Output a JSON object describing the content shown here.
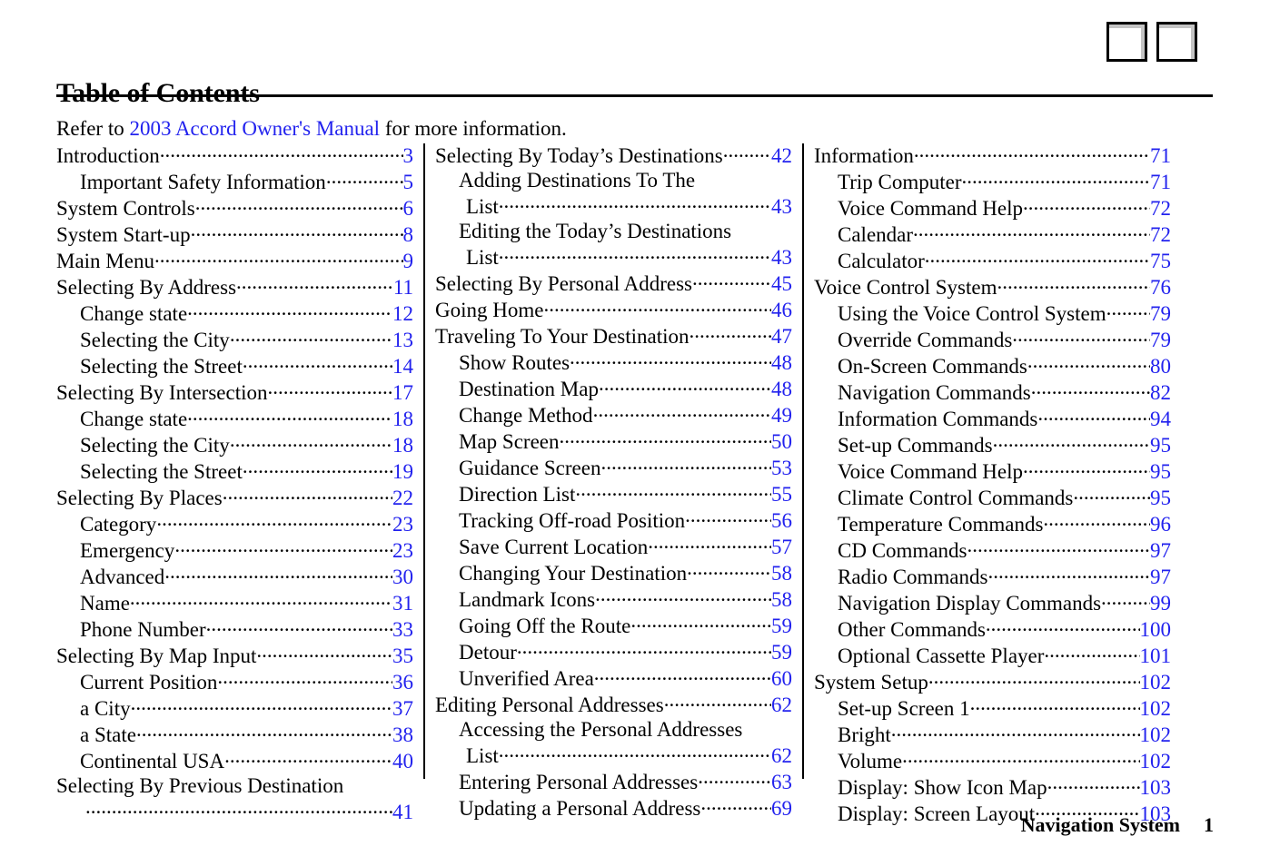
{
  "header": {
    "placeholder_boxes": [
      "image-placeholder-1",
      "image-placeholder-2"
    ]
  },
  "title": "Table of Contents",
  "intro": {
    "before": "Refer to ",
    "link": "2003 Accord Owner's Manual",
    "after": " for more information."
  },
  "columns": [
    {
      "id": "column-1",
      "entries": [
        {
          "label": "Introduction",
          "page": "3",
          "level": 1,
          "dots": true
        },
        {
          "label": "Important Safety Information",
          "page": "5",
          "level": 2,
          "dots": true
        },
        {
          "label": "System Controls",
          "page": "6",
          "level": 1,
          "dots": true
        },
        {
          "label": "System Start-up",
          "page": "8",
          "level": 1,
          "dots": true
        },
        {
          "label": "Main Menu",
          "page": "9",
          "level": 1,
          "dots": true
        },
        {
          "label": "Selecting By Address",
          "page": "11",
          "level": 1,
          "dots": true
        },
        {
          "label": "Change state",
          "page": "12",
          "level": 2,
          "dots": true
        },
        {
          "label": "Selecting the City",
          "page": "13",
          "level": 2,
          "dots": true
        },
        {
          "label": "Selecting the Street",
          "page": "14",
          "level": 2,
          "dots": true
        },
        {
          "label": "Selecting By Intersection",
          "page": "17",
          "level": 1,
          "dots": true
        },
        {
          "label": "Change state",
          "page": "18",
          "level": 2,
          "dots": true
        },
        {
          "label": "Selecting the City",
          "page": "18",
          "level": 2,
          "dots": true
        },
        {
          "label": "Selecting the Street",
          "page": "19",
          "level": 2,
          "dots": true
        },
        {
          "label": "Selecting By Places",
          "page": "22",
          "level": 1,
          "dots": true
        },
        {
          "label": "Category",
          "page": "23",
          "level": 2,
          "dots": true
        },
        {
          "label": "Emergency",
          "page": "23",
          "level": 2,
          "dots": true
        },
        {
          "label": "Advanced",
          "page": "30",
          "level": 2,
          "dots": true
        },
        {
          "label": "Name",
          "page": "31",
          "level": 2,
          "dots": true
        },
        {
          "label": "Phone Number",
          "page": "33",
          "level": 2,
          "dots": true
        },
        {
          "label": "Selecting By Map Input",
          "page": "35",
          "level": 1,
          "dots": true
        },
        {
          "label": "Current Position",
          "page": "36",
          "level": 2,
          "dots": true
        },
        {
          "label": "a City",
          "page": "37",
          "level": 2,
          "dots": true
        },
        {
          "label": "a State",
          "page": "38",
          "level": 2,
          "dots": true
        },
        {
          "label": "Continental USA",
          "page": "40",
          "level": 2,
          "dots": true
        },
        {
          "wrap_first": "Selecting By Previous Destination",
          "label": "",
          "page": "41",
          "level": 1,
          "dots": true,
          "continuation": true
        }
      ]
    },
    {
      "id": "column-2",
      "entries": [
        {
          "label": "Selecting By Today’s Destinations",
          "page": "42",
          "level": 1,
          "dots": true
        },
        {
          "wrap_first": "Adding Destinations To The",
          "label": "List",
          "page": "43",
          "level": 2,
          "dots": true,
          "continuation": true
        },
        {
          "wrap_first": "Editing the Today’s Destinations",
          "label": "List",
          "page": "43",
          "level": 2,
          "dots": true,
          "continuation": true
        },
        {
          "label": "Selecting By Personal Address",
          "page": "45",
          "level": 1,
          "dots": true
        },
        {
          "label": "Going Home",
          "page": "46",
          "level": 1,
          "dots": true
        },
        {
          "label": "Traveling To Your Destination",
          "page": "47",
          "level": 1,
          "dots": true
        },
        {
          "label": "Show Routes",
          "page": "48",
          "level": 2,
          "dots": true
        },
        {
          "label": "Destination Map",
          "page": "48",
          "level": 2,
          "dots": true
        },
        {
          "label": "Change Method",
          "page": "49",
          "level": 2,
          "dots": true
        },
        {
          "label": "Map Screen",
          "page": "50",
          "level": 2,
          "dots": true
        },
        {
          "label": "Guidance Screen",
          "page": "53",
          "level": 2,
          "dots": true
        },
        {
          "label": "Direction List",
          "page": "55",
          "level": 2,
          "dots": true
        },
        {
          "label": "Tracking Off-road Position",
          "page": "56",
          "level": 2,
          "dots": true
        },
        {
          "label": "Save Current Location",
          "page": "57",
          "level": 2,
          "dots": true
        },
        {
          "label": "Changing Your Destination",
          "page": "58",
          "level": 2,
          "dots": true
        },
        {
          "label": "Landmark Icons",
          "page": "58",
          "level": 2,
          "dots": true
        },
        {
          "label": "Going Off the Route",
          "page": "59",
          "level": 2,
          "dots": true
        },
        {
          "label": "Detour",
          "page": "59",
          "level": 2,
          "dots": true
        },
        {
          "label": "Unverified Area",
          "page": "60",
          "level": 2,
          "dots": true
        },
        {
          "label": "Editing Personal Addresses",
          "page": "62",
          "level": 1,
          "dots": true
        },
        {
          "wrap_first": "Accessing the Personal Addresses",
          "label": "List",
          "page": "62",
          "level": 2,
          "dots": true,
          "continuation": true
        },
        {
          "label": "Entering Personal Addresses",
          "page": "63",
          "level": 2,
          "dots": true
        },
        {
          "label": "Updating a Personal Address",
          "page": "69",
          "level": 2,
          "dots": true
        }
      ]
    },
    {
      "id": "column-3",
      "entries": [
        {
          "label": "Information",
          "page": "71",
          "level": 1,
          "dots": true
        },
        {
          "label": "Trip Computer",
          "page": "71",
          "level": 2,
          "dots": true
        },
        {
          "label": "Voice Command Help",
          "page": "72",
          "level": 2,
          "dots": true
        },
        {
          "label": "Calendar",
          "page": "72",
          "level": 2,
          "dots": true
        },
        {
          "label": "Calculator",
          "page": "75",
          "level": 2,
          "dots": true
        },
        {
          "label": "Voice Control System",
          "page": "76",
          "level": 1,
          "dots": true
        },
        {
          "label": "Using the Voice Control System",
          "page": "79",
          "level": 2,
          "dots": true
        },
        {
          "label": "Override Commands",
          "page": "79",
          "level": 2,
          "dots": true
        },
        {
          "label": "On-Screen Commands",
          "page": "80",
          "level": 2,
          "dots": true
        },
        {
          "label": "Navigation Commands",
          "page": "82",
          "level": 2,
          "dots": true
        },
        {
          "label": "Information Commands",
          "page": "94",
          "level": 2,
          "dots": true
        },
        {
          "label": "Set-up Commands",
          "page": "95",
          "level": 2,
          "dots": true
        },
        {
          "label": "Voice Command Help",
          "page": "95",
          "level": 2,
          "dots": true
        },
        {
          "label": "Climate Control Commands",
          "page": "95",
          "level": 2,
          "dots": true
        },
        {
          "label": "Temperature Commands",
          "page": "96",
          "level": 2,
          "dots": true
        },
        {
          "label": "CD Commands",
          "page": "97",
          "level": 2,
          "dots": true
        },
        {
          "label": "Radio Commands",
          "page": "97",
          "level": 2,
          "dots": true
        },
        {
          "label": "Navigation Display Commands",
          "page": "99",
          "level": 2,
          "dots": true
        },
        {
          "label": "Other Commands",
          "page": "100",
          "level": 2,
          "dots": true
        },
        {
          "label": "Optional Cassette Player",
          "page": "101",
          "level": 2,
          "dots": true
        },
        {
          "label": "System Setup",
          "page": "102",
          "level": 1,
          "dots": true
        },
        {
          "label": "Set-up Screen 1",
          "page": "102",
          "level": 2,
          "dots": true
        },
        {
          "label": "Bright",
          "page": "102",
          "level": 2,
          "dots": true
        },
        {
          "label": "Volume",
          "page": "102",
          "level": 2,
          "dots": true
        },
        {
          "label": "Display: Show Icon Map",
          "page": "103",
          "level": 2,
          "dots": true
        },
        {
          "label": "Display: Screen Layout",
          "page": "103",
          "level": 2,
          "dots": true
        }
      ]
    }
  ],
  "footer": {
    "manual_name": "Navigation System",
    "page_number": "1"
  },
  "colors": {
    "page_number": "#2222ee",
    "link": "#2222ee",
    "text": "#000000",
    "rule": "#000000"
  }
}
